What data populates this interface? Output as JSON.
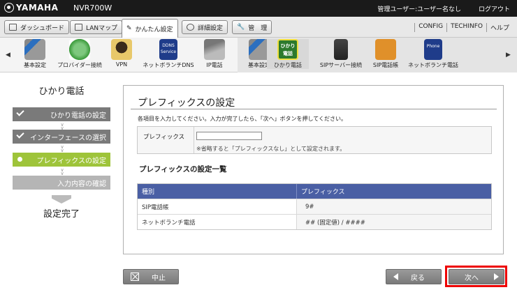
{
  "header": {
    "brand": "YAMAHA",
    "model": "NVR700W",
    "user_info": "管理ユーザー:ユーザー名なし",
    "logout": "ログアウト"
  },
  "tabs": [
    {
      "label": "ダッシュボード",
      "icon": "dashboard-icon"
    },
    {
      "label": "LANマップ",
      "icon": "lan-map-icon"
    },
    {
      "label": "かんたん設定",
      "icon": "wizard-icon",
      "active": true
    },
    {
      "label": "詳細設定",
      "icon": "gear-icon"
    },
    {
      "label": "管　理",
      "icon": "wrench-icon"
    }
  ],
  "top_links": [
    "CONFIG",
    "TECHINFO",
    "ヘルプ"
  ],
  "iconbar": {
    "left_arrow": "◀",
    "right_arrow": "▶",
    "items": [
      {
        "label": "基本設定",
        "icon": "tools-icon"
      },
      {
        "label": "プロバイダー接続",
        "icon": "globe-icon"
      },
      {
        "label": "VPN",
        "icon": "vpn-icon"
      },
      {
        "label": "ネットボランチDNS",
        "icon": "ddns-icon",
        "badge": "DDNS Service"
      },
      {
        "label": "IP電話",
        "icon": "phone-icon"
      },
      {
        "label": "基本設定",
        "icon": "tools-icon"
      },
      {
        "label": "ひかり電話",
        "icon": "hikari-denwa-icon",
        "badge": "ひかり 電話",
        "selected": true
      },
      {
        "label": "SIPサーバー接続",
        "icon": "sip-server-icon"
      },
      {
        "label": "SIP電話帳",
        "icon": "phonebook-icon"
      },
      {
        "label": "ネットボランチ電話",
        "icon": "netvolante-phone-icon",
        "badge": "Phone"
      }
    ]
  },
  "sidebar": {
    "title": "ひかり電話",
    "steps": [
      {
        "label": "ひかり電話の設定",
        "state": "done"
      },
      {
        "label": "インターフェースの選択",
        "state": "done"
      },
      {
        "label": "プレフィックスの設定",
        "state": "current"
      },
      {
        "label": "入力内容の確認",
        "state": "pending"
      }
    ],
    "done_label": "設定完了"
  },
  "panel": {
    "title": "プレフィックスの設定",
    "instruction": "各項目を入力してください。入力が完了したら、「次へ」ボタンを押してください。",
    "form": {
      "label": "プレフィックス",
      "value": "",
      "note": "※省略すると「プレフィックスなし」として設定されます。"
    },
    "list_title": "プレフィックスの設定一覧",
    "table": {
      "headers": [
        "種別",
        "プレフィックス"
      ],
      "rows": [
        [
          "SIP電話帳",
          "9#"
        ],
        [
          "ネットボランチ電話",
          "## (固定値) / ####"
        ]
      ]
    }
  },
  "buttons": {
    "cancel": "中止",
    "back": "戻る",
    "next": "次へ"
  },
  "colors": {
    "accent_green": "#9ec43a",
    "table_header": "#4a5fa4",
    "highlight_red": "#e00000"
  }
}
